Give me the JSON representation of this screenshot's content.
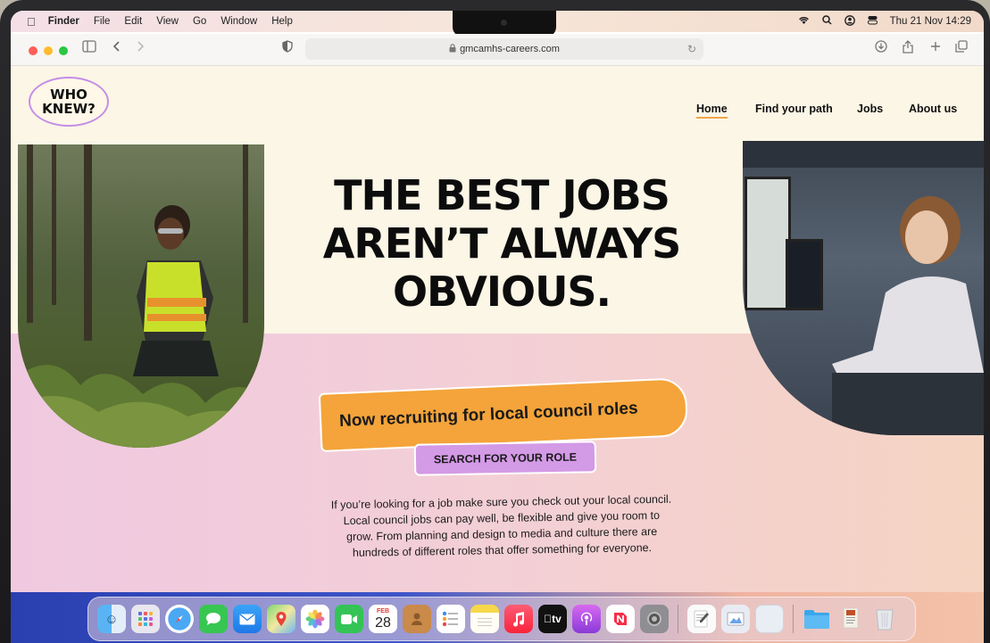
{
  "menubar": {
    "apple_icon": "apple-icon",
    "items": [
      "Finder",
      "File",
      "Edit",
      "View",
      "Go",
      "Window",
      "Help"
    ],
    "clock": "Thu 21 Nov  14:29"
  },
  "browser": {
    "url": "gmcamhs-careers.com",
    "traffic_colors": [
      "#fe5f57",
      "#febc2e",
      "#28c840"
    ]
  },
  "site": {
    "logo_line1": "WHO",
    "logo_line2": "KNEW?",
    "nav": [
      "Home",
      "Find your path",
      "Jobs",
      "About us"
    ],
    "headline_line1": "THE BEST JOBS",
    "headline_line2": "AREN’T ALWAYS",
    "headline_line3": "OBVIOUS.",
    "recruit_banner": "Now recruiting for local council roles",
    "search_button": "SEARCH FOR YOUR ROLE",
    "blurb_line1": "If you’re looking for a job make sure you check out your local council.",
    "blurb_line2": "Local council jobs can pay well, be flexible and give you room to",
    "blurb_line3": "grow. From planning and design to media and culture there are",
    "blurb_line4": "hundreds of different roles that offer something for everyone."
  },
  "dock": {
    "calendar_month": "FEB",
    "calendar_day": "28",
    "appletv_label": "tv"
  },
  "colors": {
    "accent_orange": "#f4a43a",
    "accent_purple": "#d39ae6",
    "logo_border": "#c48ee6"
  }
}
